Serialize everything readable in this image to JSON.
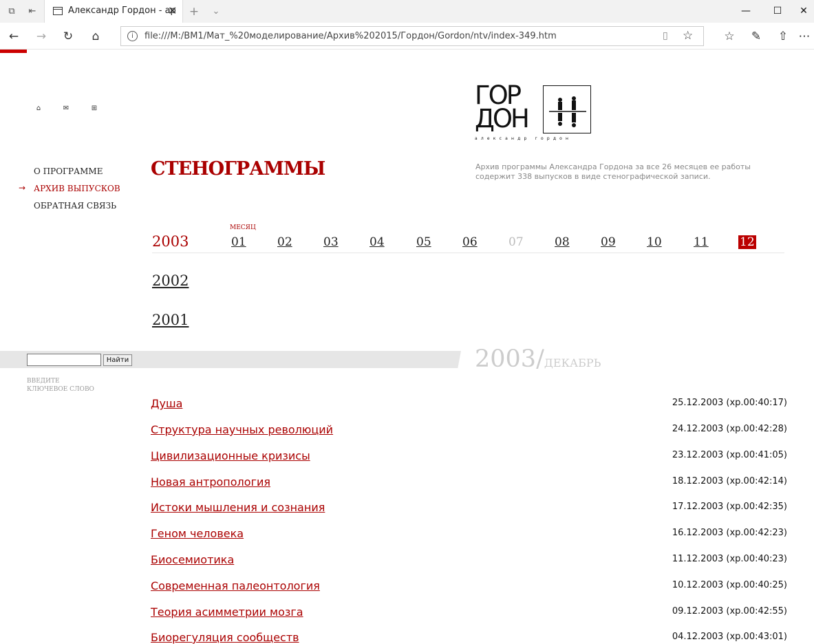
{
  "browser": {
    "tab_title": "Александр Гордон - ар",
    "url": "file:///M:/BM1/Мат_%20моделирование/Архив%202015/Гордон/Gordon/ntv/index-349.htm"
  },
  "logo": {
    "line1": "ГОР",
    "line2": "ДОН",
    "subtitle": "александр гордон"
  },
  "menu": {
    "items": [
      {
        "label": "О ПРОГРАММЕ"
      },
      {
        "label": "АРХИВ ВЫПУСКОВ"
      },
      {
        "label": "ОБРАТНАЯ СВЯЗЬ"
      }
    ]
  },
  "main": {
    "heading": "СТЕНОГРАММЫ",
    "intro": "Архив программы Александра Гордона за все 26 месяцев ее работы содержит 338 выпусков в виде стенографической записи."
  },
  "calendar": {
    "month_label": "МЕСЯЦ",
    "years": [
      "2003",
      "2002",
      "2001"
    ],
    "months": [
      "01",
      "02",
      "03",
      "04",
      "05",
      "06",
      "07",
      "08",
      "09",
      "10",
      "11",
      "12"
    ]
  },
  "search": {
    "button_label": "Найти",
    "hint_line1": "ВВЕДИТЕ",
    "hint_line2": "КЛЮЧЕВОЕ СЛОВО"
  },
  "period": {
    "year": "2003/",
    "month": "ДЕКАБРЬ"
  },
  "episodes": [
    {
      "title": "Душа",
      "date": "25.12.2003 (хр.00:40:17)"
    },
    {
      "title": "Структура научных революций",
      "date": "24.12.2003 (хр.00:42:28)"
    },
    {
      "title": "Цивилизационные кризисы",
      "date": "23.12.2003 (хр.00:41:05)"
    },
    {
      "title": "Новая антропология",
      "date": "18.12.2003 (хр.00:42:14)"
    },
    {
      "title": "Истоки мышления и сознания",
      "date": "17.12.2003 (хр.00:42:35)"
    },
    {
      "title": "Геном человека",
      "date": "16.12.2003 (хр.00:42:23)"
    },
    {
      "title": "Биосемиотика",
      "date": "11.12.2003 (хр.00:40:23)"
    },
    {
      "title": "Современная палеонтология",
      "date": "10.12.2003 (хр.00:40:25)"
    },
    {
      "title": "Теория асимметрии мозга",
      "date": "09.12.2003 (хр.00:42:55)"
    },
    {
      "title": "Биорегуляция сообществ",
      "date": "04.12.2003 (хр.00:43:01)"
    }
  ]
}
